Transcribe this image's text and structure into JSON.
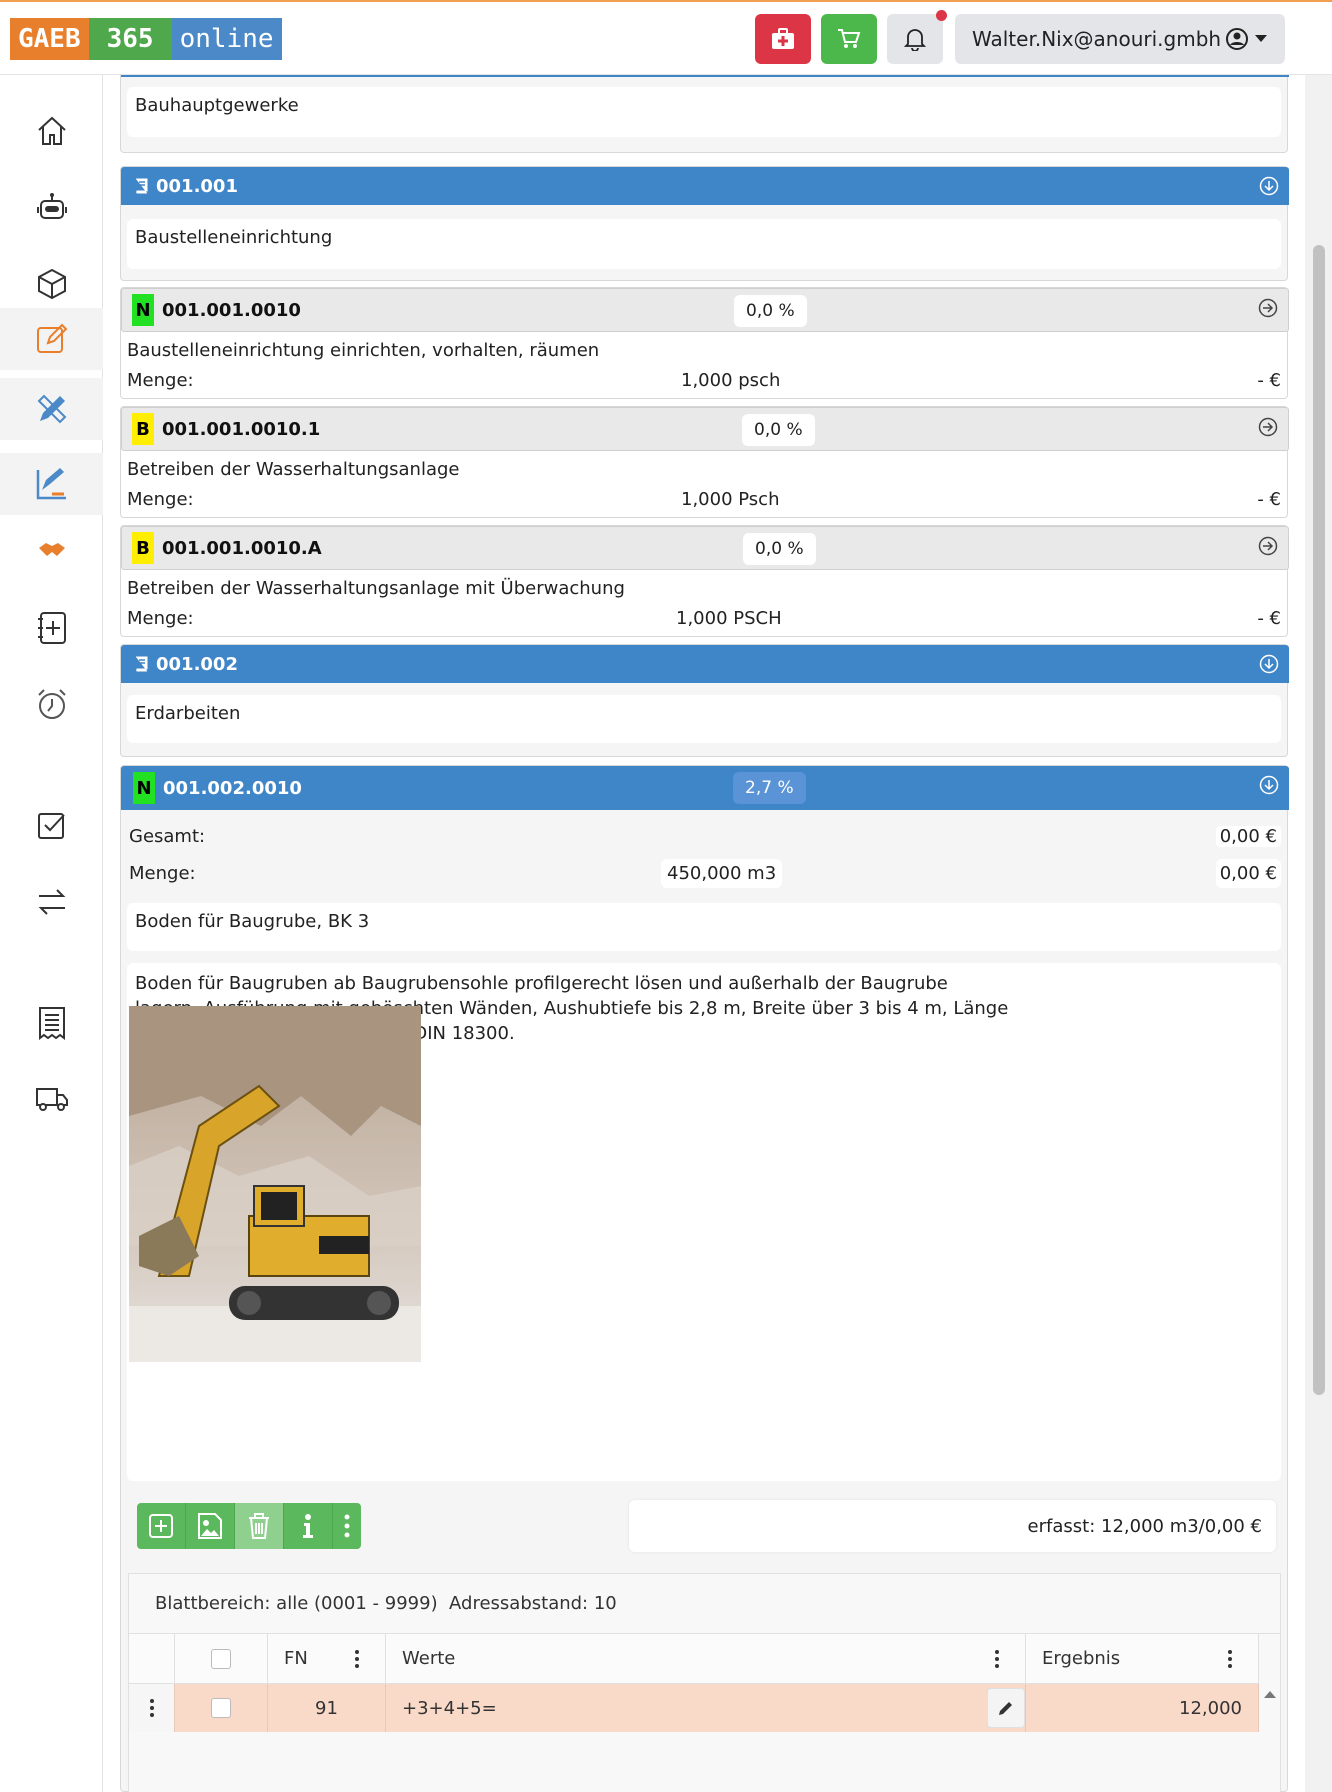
{
  "header": {
    "logo": {
      "part1": "GAEB",
      "part2": "365",
      "part3": "online"
    },
    "user": "Walter.Nix@anouri.gmbh",
    "colors": {
      "firstaid": "#dc3545",
      "cart": "#4cb84c",
      "bell": "#e3e5e8",
      "notification_dot": "#dc3545"
    }
  },
  "sidebar": {
    "icons": [
      "home-icon",
      "robot-icon",
      "cube-icon",
      "edit-icon",
      "design-tools-icon",
      "chart-edit-icon",
      "handshake-icon",
      "add-document-icon",
      "alarm-clock-icon",
      "checkbox-icon",
      "transfer-icon",
      "receipt-icon",
      "truck-icon"
    ]
  },
  "sections": {
    "top": {
      "text": "Bauhauptgewerke"
    },
    "s001001": {
      "code": "001.001",
      "text": "Baustelleneinrichtung"
    },
    "p1": {
      "badge": "N",
      "code": "001.001.0010",
      "pct": "0,0 %",
      "text": "Baustelleneinrichtung einrichten, vorhalten, räumen",
      "menge_label": "Menge:",
      "menge": "1,000 psch",
      "price": "- €"
    },
    "p2": {
      "badge": "B",
      "code": "001.001.0010.1",
      "pct": "0,0 %",
      "text": "Betreiben der Wasserhaltungsanlage",
      "menge_label": "Menge:",
      "menge": "1,000 Psch",
      "price": "- €"
    },
    "p3": {
      "badge": "B",
      "code": "001.001.0010.A",
      "pct": "0,0 %",
      "text": "Betreiben der Wasserhaltungsanlage mit Überwachung",
      "menge_label": "Menge:",
      "menge": "1,000 PSCH",
      "price": "- €"
    },
    "s001002": {
      "code": "001.002",
      "text": "Erdarbeiten"
    },
    "p4": {
      "badge": "N",
      "code": "001.002.0010",
      "pct": "2,7 %",
      "gesamt_label": "Gesamt:",
      "gesamt": "0,00 €",
      "menge_label": "Menge:",
      "menge": "450,000 m3",
      "menge_price": "0,00 €",
      "kurztext": "Boden für Baugrube, BK 3",
      "langtext_lines": [
        "Boden für Baugruben ab Baugrubensohle profilgerecht lösen und außerhalb der Baugrube",
        "lagern, Ausführung mit geböschten Wänden, Aushubtiefe bis 2,8 m, Breite über 3 bis 4 m, Länge",
        "über 3 bis 4 m, Bodenklasse 3 DIN 18300."
      ],
      "langtext_grafik": "Langtext mit Grafik",
      "erfasst": "erfasst: 12,000 m3/0,00 €"
    }
  },
  "grid": {
    "blatt": "Blattbereich: alle (0001 - 9999)  Adressabstand: 10",
    "columns": {
      "fn": "FN",
      "werte": "Werte",
      "ergebnis": "Ergebnis"
    },
    "rows": [
      {
        "fn": "91",
        "werte": "+3+4+5=",
        "ergebnis": "12,000"
      }
    ]
  }
}
